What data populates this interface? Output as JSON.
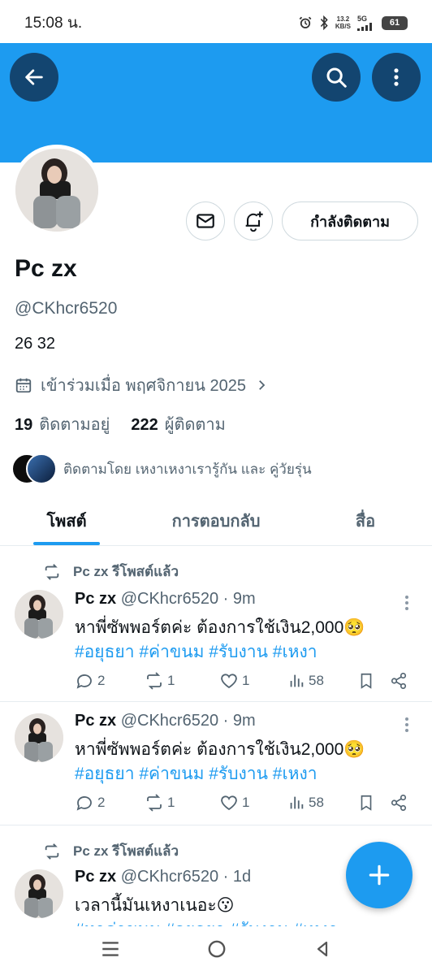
{
  "status_bar": {
    "time": "15:08 น.",
    "net_speed_value": "13.2",
    "net_speed_unit": "KB/S",
    "network": "5G",
    "battery": "61"
  },
  "profile": {
    "display_name": "Pc zx",
    "handle": "@CKhcr6520",
    "bio": "26 32",
    "joined": "เข้าร่วมเมื่อ พฤศจิกายน 2025",
    "following_count": "19",
    "following_label": "ติดตามอยู่",
    "followers_count": "222",
    "followers_label": "ผู้ติดตาม",
    "followed_by": "ติดตามโดย เหงาเหงาเรารู้กัน และ คู่วัยรุ่น",
    "follow_button": "กำลังติดตาม"
  },
  "tabs": [
    {
      "label": "โพสต์",
      "active": true
    },
    {
      "label": "การตอบกลับ",
      "active": false
    },
    {
      "label": "สื่อ",
      "active": false
    }
  ],
  "posts": [
    {
      "repost_label": "Pc zx รีโพสต์แล้ว",
      "name": "Pc zx",
      "meta": "@CKhcr6520 · 9m",
      "text": "หาพี่ซัพพอร์ตค่ะ ต้องการใช้เงิน2,000🥺",
      "tags": "#อยุธยา #ค่าขนม #รับงาน #เหงา",
      "replies": "2",
      "reposts": "1",
      "likes": "1",
      "views": "58"
    },
    {
      "repost_label": "",
      "name": "Pc zx",
      "meta": "@CKhcr6520 · 9m",
      "text": "หาพี่ซัพพอร์ตค่ะ ต้องการใช้เงิน2,000🥺",
      "tags": "#อยุธยา #ค่าขนม #รับงาน #เหงา",
      "replies": "2",
      "reposts": "1",
      "likes": "1",
      "views": "58"
    },
    {
      "repost_label": "Pc zx รีโพสต์แล้ว",
      "name": "Pc zx",
      "meta": "@CKhcr6520 · 1d",
      "text": "เวลานี้มันเหงาเนอะ😗",
      "tags": "#หาค่าขนม #อยุธยา #รับงาน #เหงา"
    }
  ],
  "colors": {
    "accent": "#1d9bf0",
    "banner": "#1d9bf0",
    "text_secondary": "#536471"
  },
  "icons": [
    "back-arrow-icon",
    "search-icon",
    "more-vertical-icon",
    "mail-icon",
    "bell-plus-icon",
    "calendar-icon",
    "chevron-right-icon",
    "repost-icon",
    "reply-icon",
    "like-icon",
    "views-icon",
    "bookmark-icon",
    "share-icon",
    "plus-icon",
    "menu-icon",
    "home-circle-icon",
    "back-triangle-icon"
  ]
}
